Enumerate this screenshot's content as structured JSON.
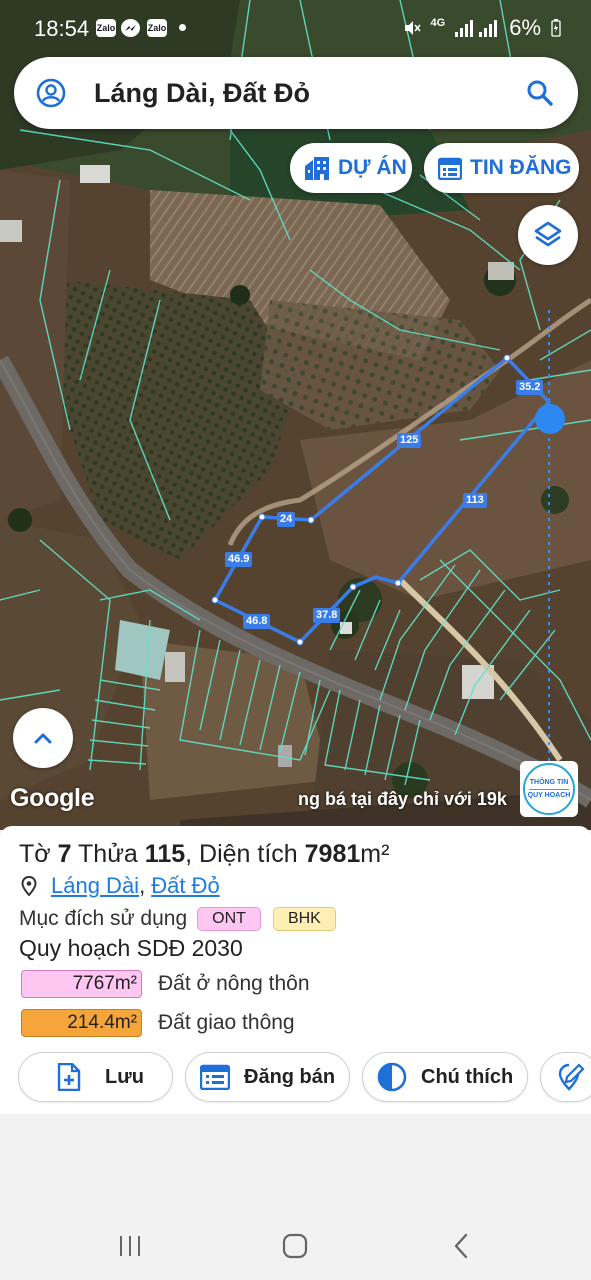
{
  "status_bar": {
    "time": "18:54",
    "notifications": [
      "Zalo",
      "messenger-icon",
      "Zalo"
    ],
    "network": "4G",
    "battery": "6%"
  },
  "search": {
    "query": "Láng Dài, Đất Đỏ"
  },
  "map_buttons": {
    "du_an": "DỰ ÁN",
    "tin_dang": "TIN ĐĂNG"
  },
  "map": {
    "google_logo": "Google",
    "ad_text": "ng bá tại đây chỉ với 19k",
    "info_badge_line1": "THÔNG TIN",
    "info_badge_line2": "QUY HOẠCH",
    "measurements": [
      "35.2",
      "125",
      "113",
      "24",
      "46.9",
      "46.8",
      "37.8"
    ],
    "boundary_color": "#3b7de8",
    "parcel_line_color": "#5fe3c8"
  },
  "parcel": {
    "to_label": "Tờ ",
    "to_value": "7",
    "thua_label": " Thửa ",
    "thua_value": "115",
    "area_label": ", Diện tích ",
    "area_value": "7981",
    "area_unit": "m²",
    "commune": "Láng Dài",
    "comma": ",",
    "district": "Đất Đỏ",
    "purpose_label": "Mục đích sử dụng",
    "purpose_tags": [
      "ONT",
      "BHK"
    ],
    "plan_title": "Quy hoạch SDĐ 2030",
    "plan_items": [
      {
        "area": "7767m²",
        "desc": "Đất ở nông thôn",
        "color": "#ffc6f2"
      },
      {
        "area": "214.4m²",
        "desc": "Đất giao thông",
        "color": "#f6a53a"
      }
    ]
  },
  "actions": {
    "save": "Lưu",
    "sell": "Đăng bán",
    "legend": "Chú thích"
  },
  "colors": {
    "accent": "#1e6fd8",
    "link": "#1e7be0"
  }
}
